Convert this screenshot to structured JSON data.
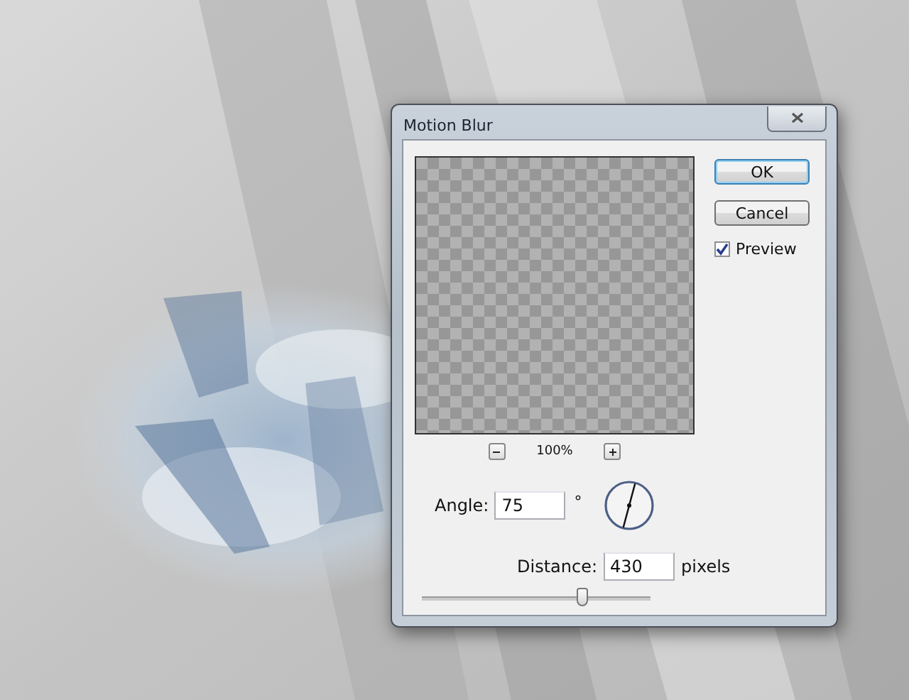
{
  "dialog": {
    "title": "Motion Blur",
    "buttons": [
      {
        "label": "OK",
        "default": true
      },
      {
        "label": "Cancel",
        "default": false
      }
    ],
    "preview": {
      "label": "Preview",
      "checked": true
    },
    "zoom": {
      "value": "100%"
    },
    "angle": {
      "label": "Angle:",
      "value": "75",
      "unit": "°"
    },
    "distance": {
      "label": "Distance:",
      "value": "430",
      "unit": "pixels",
      "level": 0.7
    }
  }
}
